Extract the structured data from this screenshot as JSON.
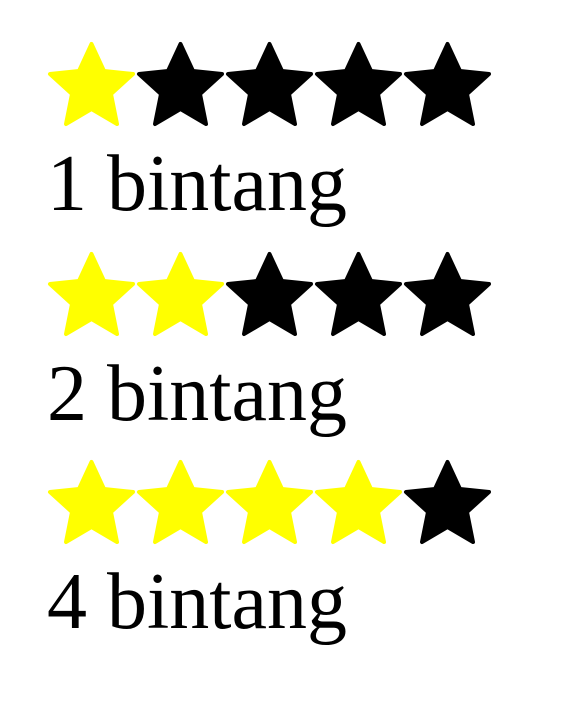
{
  "colors": {
    "filled": "#ffff00",
    "empty": "#000000"
  },
  "icons": {
    "star": "star-icon"
  },
  "ratings": [
    {
      "filled": 1,
      "max": 5,
      "label": "1 bintang"
    },
    {
      "filled": 2,
      "max": 5,
      "label": "2 bintang"
    },
    {
      "filled": 4,
      "max": 5,
      "label": "4 bintang"
    }
  ]
}
